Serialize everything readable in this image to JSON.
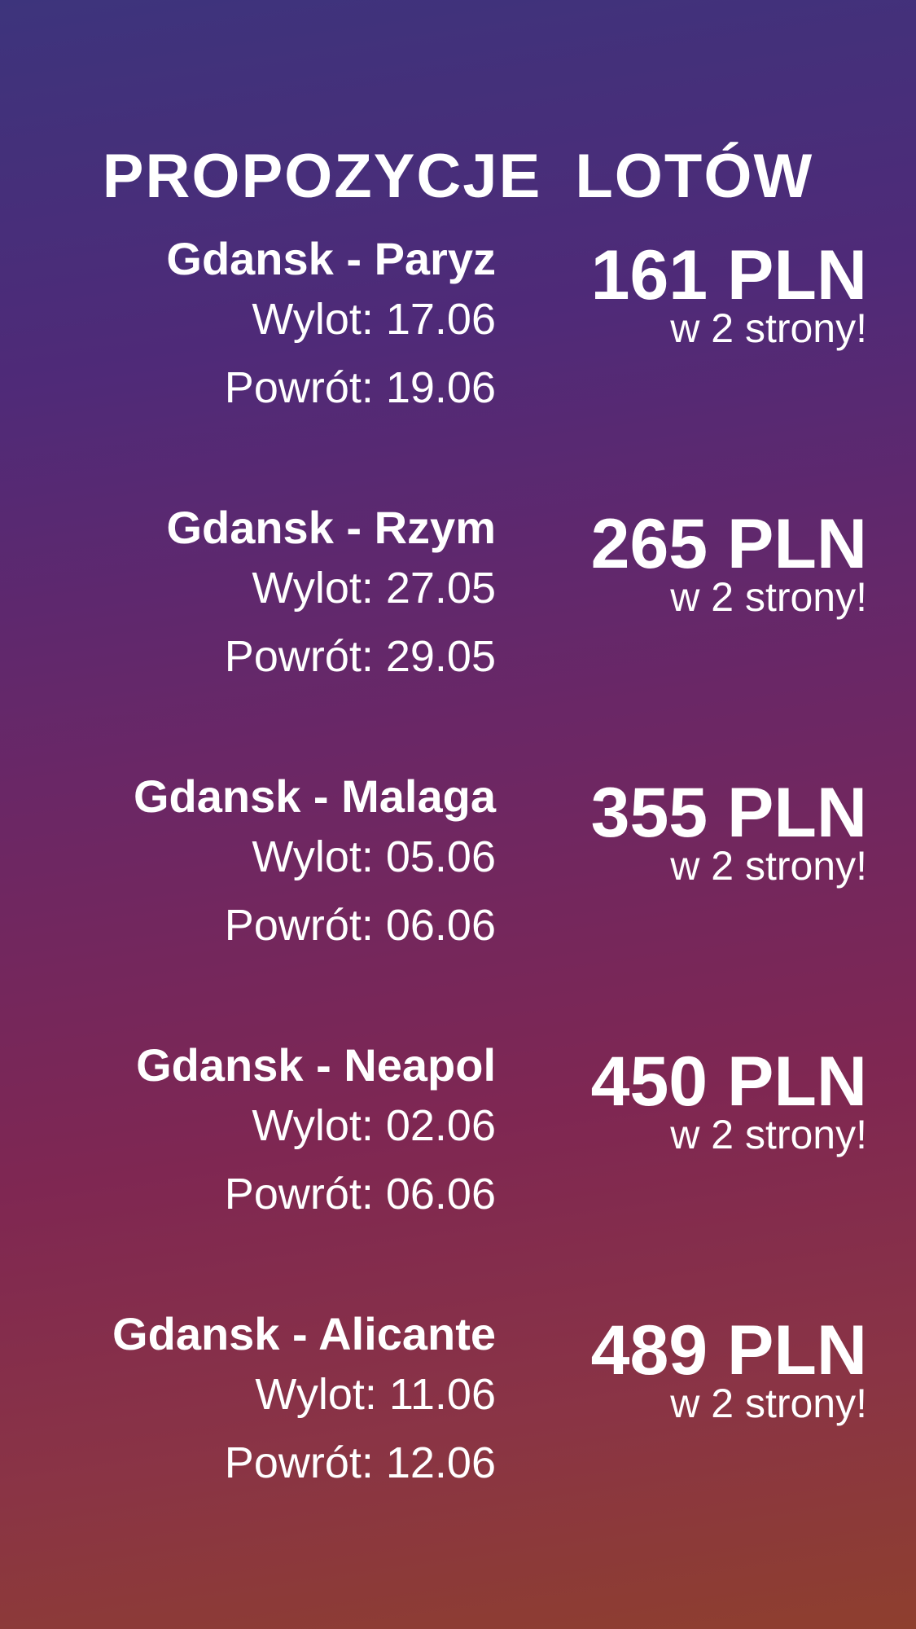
{
  "title": "PROPOZYCJE LOTÓW",
  "offers": [
    {
      "route": "Gdansk - Paryz",
      "departure": "Wylot: 17.06",
      "return": "Powrót: 19.06",
      "price": "161 PLN",
      "note": "w 2 strony!"
    },
    {
      "route": "Gdansk - Rzym",
      "departure": "Wylot: 27.05",
      "return": "Powrót: 29.05",
      "price": "265 PLN",
      "note": "w 2 strony!"
    },
    {
      "route": "Gdansk - Malaga",
      "departure": "Wylot: 05.06",
      "return": "Powrót: 06.06",
      "price": "355 PLN",
      "note": "w 2 strony!"
    },
    {
      "route": "Gdansk - Neapol",
      "departure": "Wylot: 02.06",
      "return": "Powrót: 06.06",
      "price": "450 PLN",
      "note": "w 2 strony!"
    },
    {
      "route": "Gdansk - Alicante",
      "departure": "Wylot: 11.06",
      "return": "Powrót: 12.06",
      "price": "489 PLN",
      "note": "w 2 strony!"
    }
  ],
  "colors": {
    "gradient_top": "#3d347c",
    "gradient_middle": "#7f2752",
    "gradient_bottom": "#8e3f2e",
    "text": "#ffffff"
  }
}
